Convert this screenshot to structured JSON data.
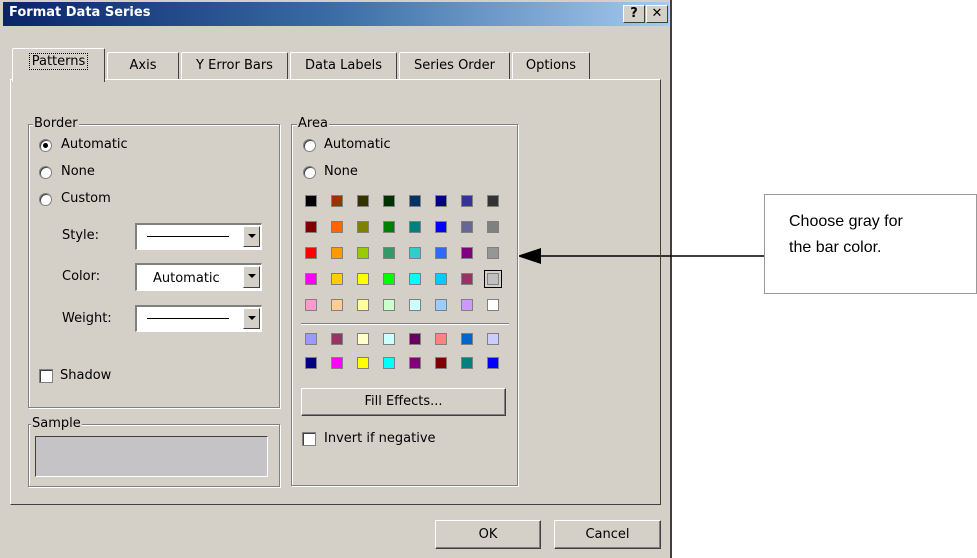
{
  "dialog": {
    "title": "Format Data Series",
    "help_label": "?",
    "close_label": "✕"
  },
  "tabs": [
    "Patterns",
    "Axis",
    "Y Error Bars",
    "Data Labels",
    "Series Order",
    "Options"
  ],
  "border": {
    "group_label": "Border",
    "automatic": "Automatic",
    "none": "None",
    "custom": "Custom",
    "selected": "Automatic",
    "style_label": "Style:",
    "color_label": "Color:",
    "color_value": "Automatic",
    "weight_label": "Weight:",
    "shadow_label": "Shadow"
  },
  "sample": {
    "group_label": "Sample",
    "color": "#c6c3c6"
  },
  "area": {
    "group_label": "Area",
    "automatic": "Automatic",
    "none": "None",
    "fill_effects": "Fill Effects...",
    "invert_label": "Invert if negative",
    "selected_color": "#c0c0c0",
    "palette_main": [
      [
        "#000000",
        "#993300",
        "#333300",
        "#003300",
        "#003366",
        "#000080",
        "#333399",
        "#333333"
      ],
      [
        "#800000",
        "#ff6600",
        "#808000",
        "#008000",
        "#008080",
        "#0000ff",
        "#666699",
        "#808080"
      ],
      [
        "#ff0000",
        "#ff9900",
        "#99cc00",
        "#339966",
        "#33cccc",
        "#3366ff",
        "#800080",
        "#969696"
      ],
      [
        "#ff00ff",
        "#ffcc00",
        "#ffff00",
        "#00ff00",
        "#00ffff",
        "#00ccff",
        "#993366",
        "#c0c0c0"
      ],
      [
        "#ff99cc",
        "#ffcc99",
        "#ffff99",
        "#ccffcc",
        "#ccffff",
        "#99ccff",
        "#cc99ff",
        "#ffffff"
      ]
    ],
    "palette_chart": [
      [
        "#9999ff",
        "#993366",
        "#ffffcc",
        "#ccffff",
        "#660066",
        "#ff8080",
        "#0066cc",
        "#ccccff"
      ],
      [
        "#000080",
        "#ff00ff",
        "#ffff00",
        "#00ffff",
        "#800080",
        "#800000",
        "#008080",
        "#0000ff"
      ]
    ]
  },
  "buttons": {
    "ok": "OK",
    "cancel": "Cancel"
  },
  "callout": {
    "line1": "Choose gray for",
    "line2": "the bar color."
  }
}
